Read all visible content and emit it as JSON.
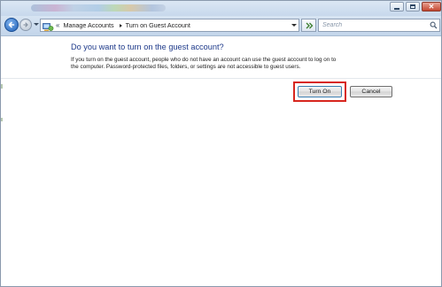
{
  "window": {
    "controls": [
      {
        "icon": "minimize-icon"
      },
      {
        "icon": "maximize-icon"
      },
      {
        "icon": "close-icon",
        "glyph": "✕"
      }
    ]
  },
  "navigation": {
    "back_icon": "back-arrow-icon",
    "forward_icon": "forward-arrow-icon",
    "overflow_glyph": "«",
    "breadcrumb": [
      "Manage Accounts",
      "Turn on Guest Account"
    ],
    "refresh_icon": "refresh-icon",
    "search": {
      "placeholder": "Search",
      "icon": "search-icon"
    }
  },
  "dialog": {
    "title": "Do you want to turn on the guest account?",
    "description": [
      "If you turn on the guest account, people who do not have an account can use the guest account to log on to",
      "the computer. Password-protected files, folders, or settings are not accessible to guest users."
    ],
    "buttons": {
      "turn_on": "Turn On",
      "cancel": "Cancel"
    },
    "highlight_color": "#d7261e"
  },
  "colors": {
    "heading": "#1e3a8a",
    "chrome": "#c7d8ec"
  }
}
